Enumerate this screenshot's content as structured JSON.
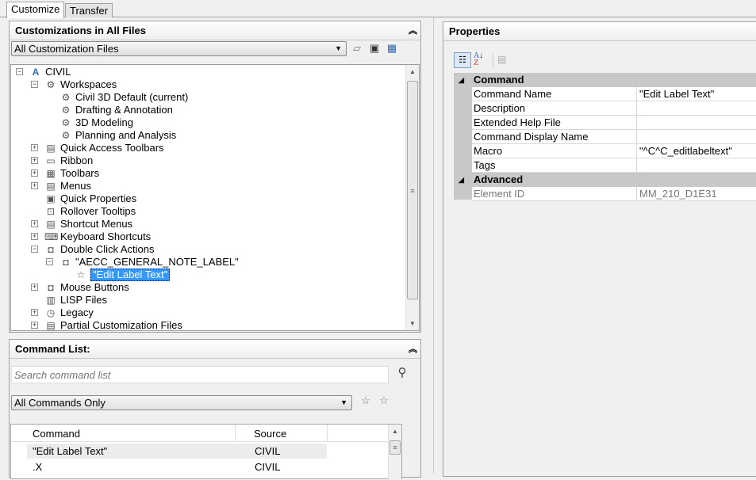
{
  "tabs": [
    {
      "label": "Customize",
      "active": true
    },
    {
      "label": "Transfer",
      "active": false
    }
  ],
  "customizations": {
    "title": "Customizations in All Files",
    "file_filter": "All Customization Files",
    "tools": [
      "open-file-icon",
      "save-icon",
      "load-partial-icon"
    ],
    "tree": [
      {
        "label": "CIVIL",
        "icon": "autocad-a-icon",
        "expanded": true
      },
      {
        "label": "Workspaces",
        "icon": "workspaces-gear-icon",
        "expanded": true
      },
      {
        "label": "Civil 3D Default (current)",
        "icon": "gear-icon"
      },
      {
        "label": "Drafting & Annotation",
        "icon": "gear-icon"
      },
      {
        "label": "3D Modeling",
        "icon": "gear-icon"
      },
      {
        "label": "Planning and Analysis",
        "icon": "gear-icon"
      },
      {
        "label": "Quick Access Toolbars",
        "icon": "toolbar-icon",
        "expanded": false
      },
      {
        "label": "Ribbon",
        "icon": "ribbon-icon",
        "expanded": false
      },
      {
        "label": "Toolbars",
        "icon": "toolbars-icon",
        "expanded": false
      },
      {
        "label": "Menus",
        "icon": "menus-icon",
        "expanded": false
      },
      {
        "label": "Quick Properties",
        "icon": "quick-properties-icon"
      },
      {
        "label": "Rollover Tooltips",
        "icon": "rollover-icon"
      },
      {
        "label": "Shortcut Menus",
        "icon": "shortcut-menu-icon",
        "expanded": false
      },
      {
        "label": "Keyboard Shortcuts",
        "icon": "keyboard-icon",
        "expanded": false
      },
      {
        "label": "Double Click Actions",
        "icon": "mouse-icon",
        "expanded": true
      },
      {
        "label": "\"AECC_GENERAL_NOTE_LABEL\"",
        "icon": "mouse-icon",
        "expanded": true
      },
      {
        "label": "\"Edit Label Text\"",
        "icon": "star-icon",
        "selected": true
      },
      {
        "label": "Mouse Buttons",
        "icon": "mouse-icon",
        "expanded": false
      },
      {
        "label": "LISP Files",
        "icon": "lisp-icon"
      },
      {
        "label": "Legacy",
        "icon": "legacy-clock-icon",
        "expanded": false
      },
      {
        "label": "Partial Customization Files",
        "icon": "cui-icon",
        "expanded": false
      }
    ]
  },
  "command_list": {
    "title": "Command List:",
    "search_placeholder": "Search command list",
    "filter": "All Commands Only",
    "columns": [
      "Command",
      "Source"
    ],
    "rows": [
      {
        "command": "\"Edit Label Text\"",
        "source": "CIVIL"
      },
      {
        "command": ".X",
        "source": "CIVIL"
      }
    ]
  },
  "properties": {
    "title": "Properties",
    "categories": [
      {
        "name": "Command",
        "props": [
          {
            "name": "Command Name",
            "value": "\"Edit Label Text\""
          },
          {
            "name": "Description",
            "value": ""
          },
          {
            "name": "Extended Help File",
            "value": ""
          },
          {
            "name": "Command Display Name",
            "value": ""
          },
          {
            "name": "Macro",
            "value": "\"^C^C_editlabeltext\""
          },
          {
            "name": "Tags",
            "value": ""
          }
        ]
      },
      {
        "name": "Advanced",
        "props": [
          {
            "name": "Element ID",
            "value": "MM_210_D1E31",
            "readonly": true
          }
        ]
      }
    ]
  }
}
